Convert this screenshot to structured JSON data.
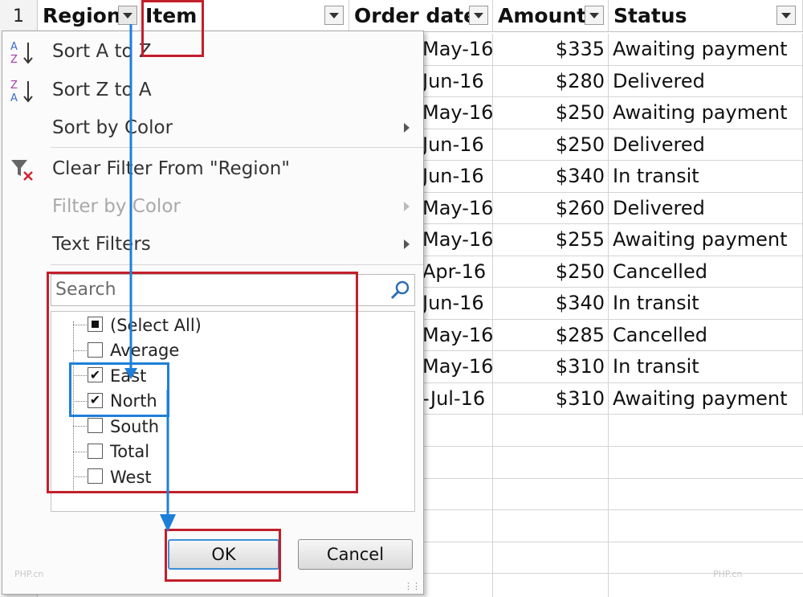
{
  "row_number": "1",
  "columns": [
    {
      "label": "Region",
      "filtered": true
    },
    {
      "label": "Item",
      "filtered": false
    },
    {
      "label": "Order date",
      "filtered": false
    },
    {
      "label": "Amount",
      "filtered": false
    },
    {
      "label": "Status",
      "filtered": false
    }
  ],
  "rows": [
    {
      "order_date": "May-16",
      "amount": "$335",
      "status": "Awaiting payment"
    },
    {
      "order_date": "Jun-16",
      "amount": "$280",
      "status": "Delivered"
    },
    {
      "order_date": "May-16",
      "amount": "$250",
      "status": "Awaiting payment"
    },
    {
      "order_date": "Jun-16",
      "amount": "$250",
      "status": "Delivered"
    },
    {
      "order_date": "Jun-16",
      "amount": "$340",
      "status": "In transit"
    },
    {
      "order_date": "May-16",
      "amount": "$260",
      "status": "Delivered"
    },
    {
      "order_date": "May-16",
      "amount": "$255",
      "status": "Awaiting payment"
    },
    {
      "order_date": "Apr-16",
      "amount": "$250",
      "status": "Cancelled"
    },
    {
      "order_date": "Jun-16",
      "amount": "$340",
      "status": "In transit"
    },
    {
      "order_date": "May-16",
      "amount": "$285",
      "status": "Cancelled"
    },
    {
      "order_date": "May-16",
      "amount": "$310",
      "status": "In transit"
    },
    {
      "order_date": "-Jul-16",
      "amount": "$310",
      "status": "Awaiting payment"
    }
  ],
  "filter_menu": {
    "sort_az": "Sort A to Z",
    "sort_za": "Sort Z to A",
    "sort_by_color": "Sort by Color",
    "clear_filter": "Clear Filter From \"Region\"",
    "filter_by_color": "Filter by Color",
    "text_filters": "Text Filters",
    "search_placeholder": "Search",
    "items": [
      {
        "label": "(Select All)",
        "state": "partial"
      },
      {
        "label": "Average",
        "state": "unchecked"
      },
      {
        "label": "East",
        "state": "checked"
      },
      {
        "label": "North",
        "state": "checked"
      },
      {
        "label": "South",
        "state": "unchecked"
      },
      {
        "label": "Total",
        "state": "unchecked"
      },
      {
        "label": "West",
        "state": "unchecked"
      }
    ],
    "ok_label": "OK",
    "cancel_label": "Cancel"
  },
  "icons": [
    "sort-a-to-z-icon",
    "sort-z-to-a-icon",
    "clear-filter-icon",
    "search-icon",
    "filter-dropdown-icon",
    "checkmark-icon"
  ],
  "colors": {
    "annotation_red": "#c21f2b",
    "annotation_blue": "#1e7fd8"
  },
  "watermarks": [
    "PHP.cn",
    "PHP.cn"
  ]
}
